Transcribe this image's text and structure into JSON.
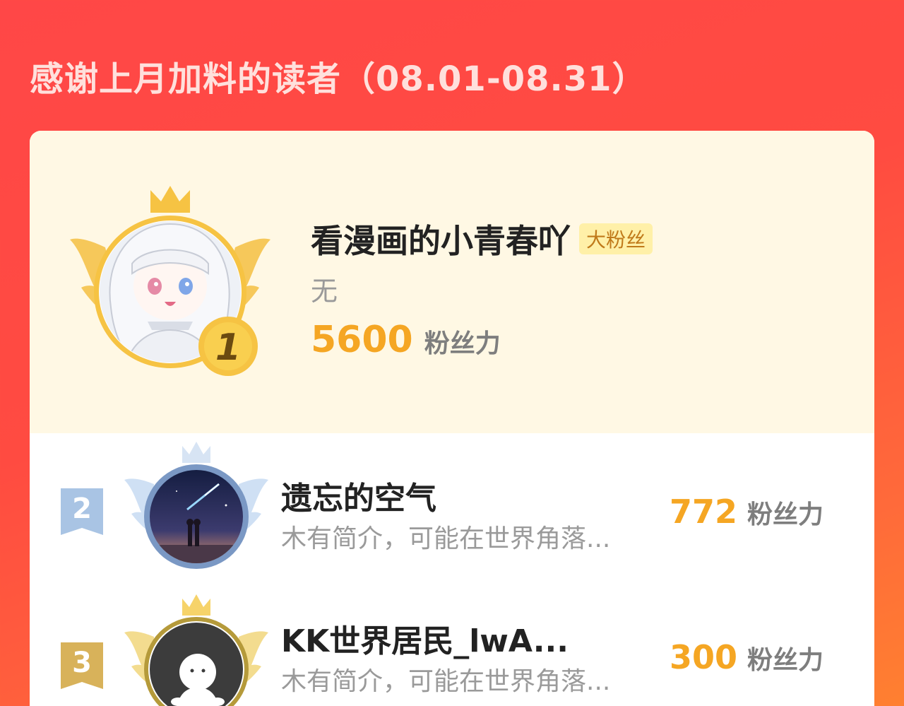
{
  "header": {
    "title": "感谢上月加料的读者（08.01-08.31）"
  },
  "top_user": {
    "rank": "1",
    "name": "看漫画的小青春吖",
    "tag": "大粉丝",
    "bio": "无",
    "score": "5600",
    "score_unit": "粉丝力",
    "avatar": "anime-girl-avatar"
  },
  "ranking": [
    {
      "rank": "2",
      "name": "遗忘的空气",
      "bio": "木有简介，可能在世界角落...",
      "score": "772",
      "score_unit": "粉丝力",
      "avatar": "couple-night-sky-avatar"
    },
    {
      "rank": "3",
      "name": "KK世界居民_lwA...",
      "bio": "木有简介，可能在世界角落...",
      "score": "300",
      "score_unit": "粉丝力",
      "avatar": "default-ghost-avatar"
    }
  ],
  "colors": {
    "background": "#ff4b41",
    "score": "#f5a623",
    "gold": "#f6c343",
    "silver": "#a9c4e4",
    "bronze": "#d8b25a"
  }
}
